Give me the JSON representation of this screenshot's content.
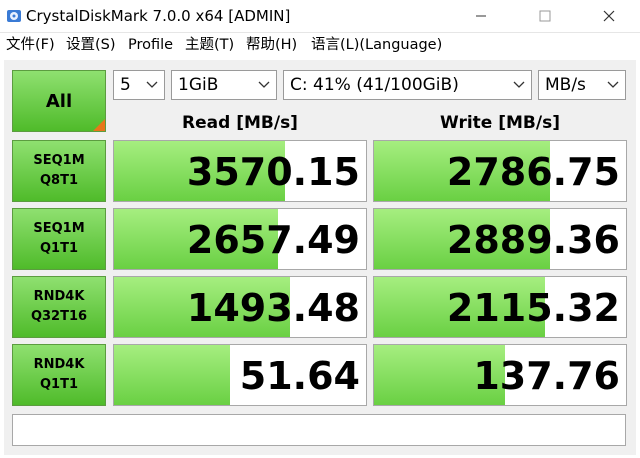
{
  "window": {
    "title": "CrystalDiskMark 7.0.0 x64 [ADMIN]"
  },
  "menu": [
    "文件(F)",
    "设置(S)",
    "Profile",
    "主题(T)",
    "帮助(H)",
    "语言(L)(Language)"
  ],
  "controls": {
    "all_label": "All",
    "count": "5",
    "size": "1GiB",
    "drive": "C: 41% (41/100GiB)",
    "unit": "MB/s"
  },
  "headers": {
    "read": "Read [MB/s]",
    "write": "Write [MB/s]"
  },
  "tests": [
    {
      "line1": "SEQ1M",
      "line2": "Q8T1",
      "read": "3570.15",
      "write": "2786.75",
      "read_fill": 0.68,
      "write_fill": 0.7
    },
    {
      "line1": "SEQ1M",
      "line2": "Q1T1",
      "read": "2657.49",
      "write": "2889.36",
      "read_fill": 0.65,
      "write_fill": 0.7
    },
    {
      "line1": "RND4K",
      "line2": "Q32T16",
      "read": "1493.48",
      "write": "2115.32",
      "read_fill": 0.7,
      "write_fill": 0.68
    },
    {
      "line1": "RND4K",
      "line2": "Q1T1",
      "read": "51.64",
      "write": "137.76",
      "read_fill": 0.46,
      "write_fill": 0.52
    }
  ],
  "status": ""
}
